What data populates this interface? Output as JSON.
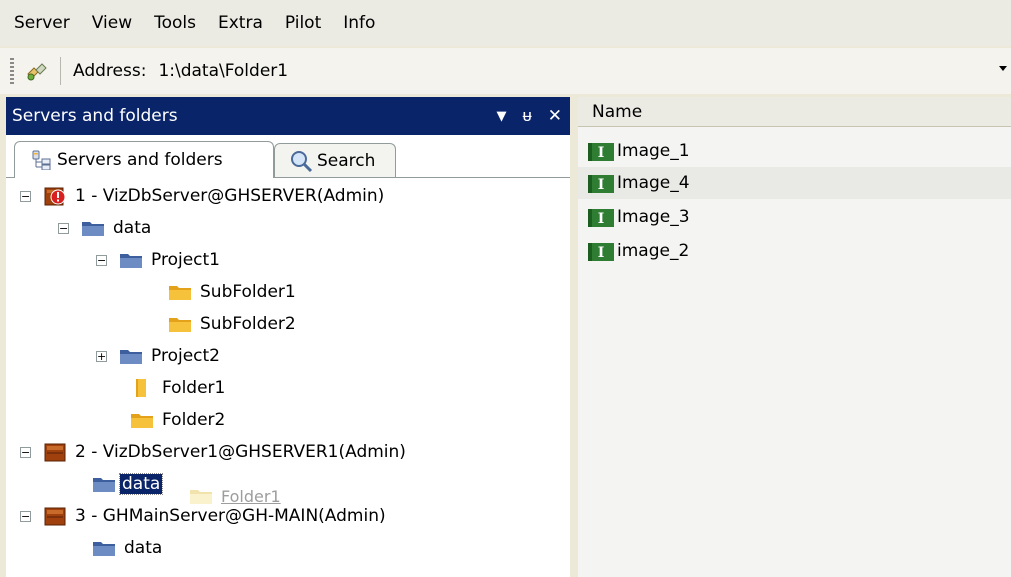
{
  "menu": [
    "Server",
    "View",
    "Tools",
    "Extra",
    "Pilot",
    "Info"
  ],
  "toolbar": {
    "address_label": "Address:",
    "address_value": "1:\\data\\Folder1"
  },
  "left_panel": {
    "title": "Servers and folders",
    "controls": [
      "▼",
      "ᵾ",
      "✕"
    ],
    "tabs": [
      {
        "label": "Servers and folders"
      },
      {
        "label": "Search"
      }
    ]
  },
  "tree": [
    {
      "label": "1 - VizDbServer@GHSERVER(Admin)",
      "expander": "−",
      "icon": "server-alert-icon"
    },
    {
      "label": "data",
      "expander": "−",
      "icon": "blue-folder-icon"
    },
    {
      "label": "Project1",
      "expander": "−",
      "icon": "blue-folder-icon"
    },
    {
      "label": "SubFolder1",
      "icon": "yellow-folder-icon"
    },
    {
      "label": "SubFolder2",
      "icon": "yellow-folder-icon"
    },
    {
      "label": "Project2",
      "expander": "+",
      "icon": "blue-folder-icon"
    },
    {
      "label": "Folder1",
      "icon": "open-folder-icon"
    },
    {
      "label": "Folder2",
      "icon": "yellow-folder-icon"
    },
    {
      "label": "2 - VizDbServer1@GHSERVER1(Admin)",
      "expander": "−",
      "icon": "server-icon"
    },
    {
      "label": "data",
      "icon": "blue-folder-icon",
      "selected": true
    },
    {
      "label": "3 - GHMainServer@GH-MAIN(Admin)",
      "expander": "−",
      "icon": "server-icon"
    },
    {
      "label": "data",
      "icon": "blue-folder-icon"
    }
  ],
  "drag_ghost": {
    "label": "Folder1",
    "icon": "yellow-folder-icon"
  },
  "right_panel": {
    "column_header": "Name",
    "items": [
      "Image_1",
      "Image_4",
      "Image_3",
      "image_2"
    ]
  },
  "colors": {
    "title_bar": "#0a246a",
    "selection": "#0a246a",
    "folder_blue": "#3d5f9e",
    "folder_yellow": "#f6c23b",
    "image_icon_green": "#2e7d32",
    "server_brown": "#a0400c"
  }
}
